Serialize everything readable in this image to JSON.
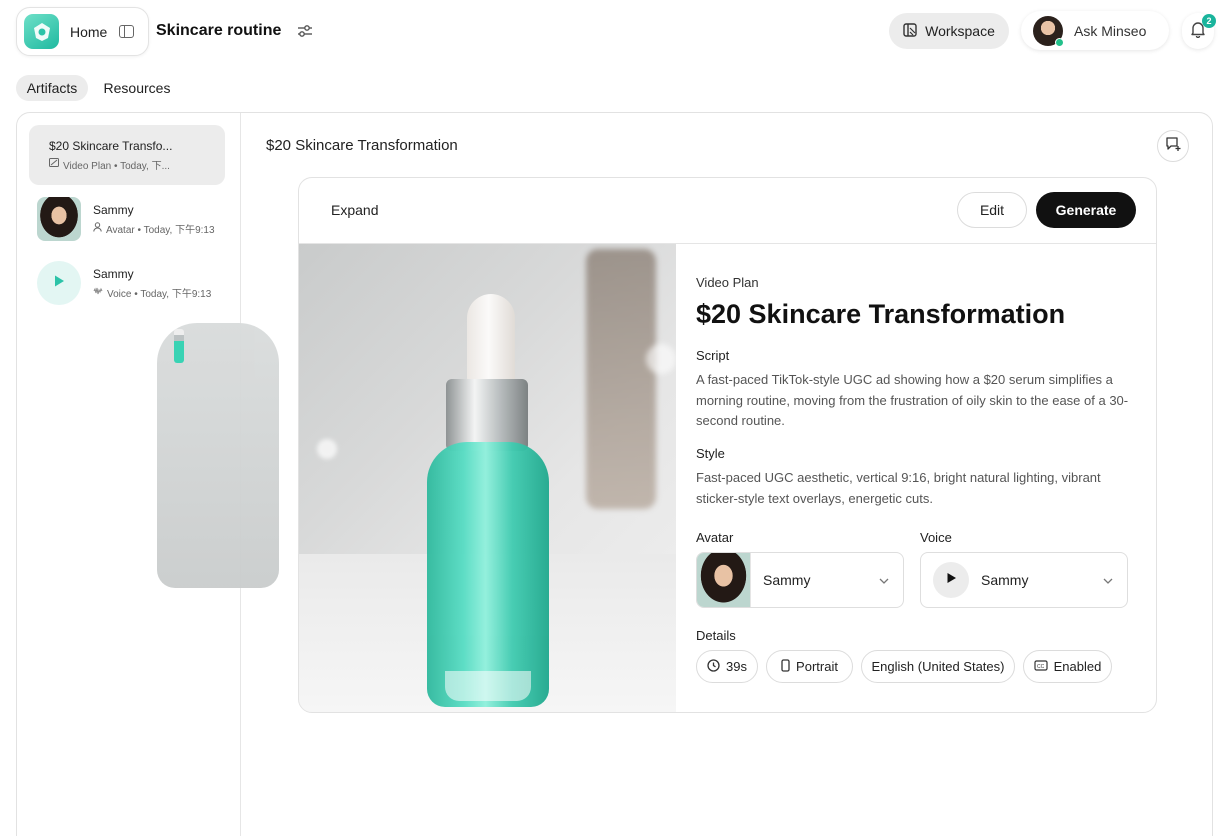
{
  "header": {
    "home_label": "Home",
    "project_title": "Skincare routine",
    "workspace_label": "Workspace",
    "ask_label": "Ask Minseo",
    "notification_count": "2"
  },
  "tabs": [
    {
      "label": "Artifacts",
      "active": true
    },
    {
      "label": "Resources",
      "active": false
    }
  ],
  "artifacts": [
    {
      "title": "$20 Skincare Transfo...",
      "meta": "Video Plan • Today, 下...",
      "icon": "video-plan-icon",
      "selected": true
    },
    {
      "title": "Sammy",
      "meta": "Avatar • Today, 下午9:13",
      "icon": "person-icon",
      "selected": false
    },
    {
      "title": "Sammy",
      "meta": "Voice • Today, 下午9:13",
      "icon": "waveform-icon",
      "selected": false
    }
  ],
  "content": {
    "title": "$20 Skincare Transformation"
  },
  "card": {
    "expand_label": "Expand",
    "edit_label": "Edit",
    "generate_label": "Generate",
    "eyebrow": "Video Plan",
    "title": "$20 Skincare Transformation",
    "script_label": "Script",
    "script_body": "A fast-paced TikTok-style UGC ad showing how a $20 serum simplifies a morning routine, moving from the frustration of oily skin to the ease of a 30-second routine.",
    "style_label": "Style",
    "style_body": "Fast-paced UGC aesthetic, vertical 9:16, bright natural lighting, vibrant sticker-style text overlays, energetic cuts.",
    "avatar_label": "Avatar",
    "avatar_value": "Sammy",
    "voice_label": "Voice",
    "voice_value": "Sammy",
    "details_label": "Details",
    "chips": [
      {
        "icon": "clock-icon",
        "label": "39s"
      },
      {
        "icon": "phone-portrait-icon",
        "label": "Portrait"
      },
      {
        "icon": "",
        "label": "English (United States)"
      },
      {
        "icon": "captions-icon",
        "label": "Enabled"
      }
    ]
  },
  "colors": {
    "accent": "#1ab49c",
    "primary_button": "#111111",
    "tab_active_bg": "#ececec"
  }
}
